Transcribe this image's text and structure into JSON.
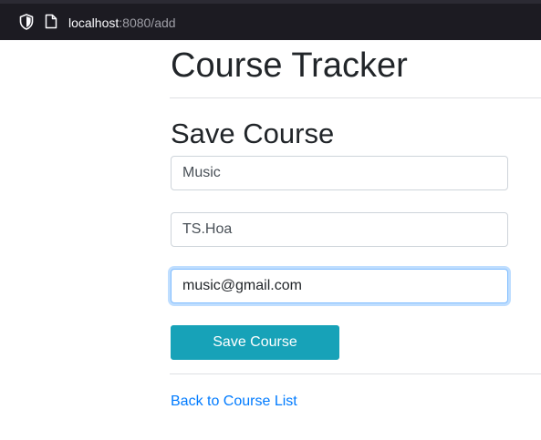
{
  "browser": {
    "url_host": "localhost",
    "url_rest": ":8080/add",
    "icons": [
      "shield-icon",
      "page-icon"
    ]
  },
  "header": {
    "title": "Course Tracker"
  },
  "form": {
    "title": "Save Course",
    "fields": {
      "name": "Music",
      "instructor": "TS.Hoa",
      "email": "music@gmail.com"
    },
    "submit_label": "Save Course"
  },
  "footer": {
    "back_link_label": "Back to Course List"
  },
  "colors": {
    "button": "#17a2b8",
    "link": "#007bff",
    "focus_border": "#80bdff",
    "browser_bar": "#1c1b22"
  }
}
